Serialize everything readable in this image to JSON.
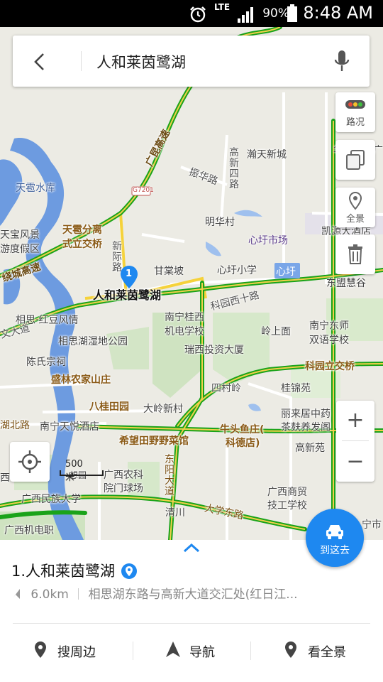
{
  "status_bar": {
    "lte": "LTE",
    "battery": "90%",
    "time": "8:48 AM"
  },
  "search": {
    "query": "人和莱茵鹭湖"
  },
  "map_controls": {
    "traffic_label": "路况",
    "panorama_label": "全景",
    "zoom_in": "+",
    "zoom_out": "−",
    "scale_label": "500米"
  },
  "map_labels": {
    "highway_kunming": "广昆高速",
    "highway_ring": "绕城高速",
    "g7201": "G7201",
    "tianxiu_reservoir": "天雹水库",
    "tianbao_scenic": "天宝风景",
    "tianbao_resort": "游度假区",
    "tianxiao_interchange_1": "天雹分离",
    "tianxiao_interchange_2": "式立交桥",
    "xinji_road": "新际路",
    "zhenhua_road": "振华路",
    "gaoxin_4th_road": "高新四路",
    "hantian_xincheng": "瀚天新城",
    "huashang_times": "华商时代广",
    "mingye_village": "明华村",
    "xinxu_market": "心圩市场",
    "kaiyuan_hotel": "凯源大酒店",
    "gantang_po": "甘棠坡",
    "xinxu_primary": "心圩小学",
    "xinxu_badge": "心圩",
    "kelong_west_road": "科园西十路",
    "dongmeng_huigu": "东盟慧谷",
    "pin_number": "1",
    "pin_title": "人和莱茵鹭湖",
    "xiangsi_hongdou": "相思·红豆风情",
    "xiangsihu_wetland": "相思湖湿地公园",
    "guixi_school_1": "南宁桂西",
    "guixi_school_2": "机电学校",
    "lingshang_mian": "岭上面",
    "nanning_dongshi_1": "南宁东师",
    "nanning_dongshi_2": "双语学校",
    "ruixi_tower": "瑞西投资大厦",
    "chen_ancestral": "陈氏宗祠",
    "wenhua_road": "文大道",
    "shenglin_villa": "盛林农家山庄",
    "keyuan_interchange": "科园立交桥",
    "tuncun_ling": "四村岭",
    "guijin_yuan": "桂锦苑",
    "bagui_garden": "八桂田园",
    "daling_village": "大岭新村",
    "lilaiju_1": "丽来居中药",
    "lilaiju_2": "茶麸养发阁",
    "hubei_road": "湖北路",
    "tianyue_hotel": "南宁天悦酒店",
    "xiwang_vegetable": "希望田野野菜馆",
    "niutou_yuzhuang_1": "牛头鱼庄(",
    "niutou_yuzhuang_2": "科德店)",
    "gaoxin_yuan": "高新苑",
    "xiangsi_yuan": "想园",
    "gx_agri_1": "广西农科",
    "gx_agri_2": "院门球场",
    "dongyang_ave": "东阳大道",
    "gx_commerce_1": "广西商贸",
    "gx_commerce_2": "技工学校",
    "gx_minzu": "广西民族大学",
    "qingchuan": "清川",
    "university_east": "大学东路",
    "gx_electromech": "广西机电职",
    "nanning_city_edge": "宁市",
    "west_edge": "西"
  },
  "go_button": {
    "label": "到这去"
  },
  "result_panel": {
    "title": "1.人和莱茵鹭湖",
    "distance": "6.0km",
    "address": "相思湖东路与高新大道交汇处(红日江..."
  },
  "actions": [
    {
      "label": "搜周边"
    },
    {
      "label": "导航"
    },
    {
      "label": "看全景"
    }
  ],
  "colors": {
    "accent": "#1e88f0",
    "traffic_green": "#1aa31a",
    "road_yellow": "#f5d23a",
    "water": "#6d9be0"
  }
}
